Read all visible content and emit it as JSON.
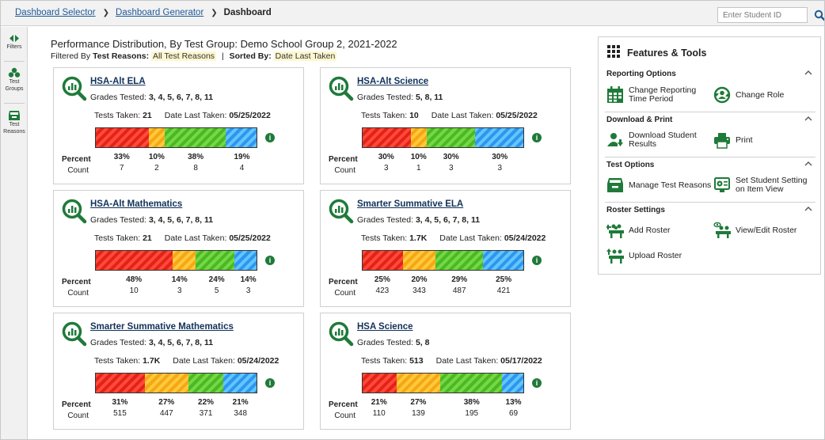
{
  "breadcrumb": {
    "items": [
      "Dashboard Selector",
      "Dashboard Generator"
    ],
    "current": "Dashboard",
    "separator": "❯"
  },
  "search": {
    "placeholder": "Enter Student ID",
    "icon": "search-icon"
  },
  "sidebar": {
    "items": [
      {
        "label1": "Filters",
        "label2": "",
        "icon": "filters-icon"
      },
      {
        "label1": "Test",
        "label2": "Groups",
        "icon": "test-groups-icon"
      },
      {
        "label1": "Test",
        "label2": "Reasons",
        "icon": "test-reasons-icon"
      }
    ]
  },
  "header": {
    "title": "Performance Distribution, By Test Group: Demo School Group 2, 2021-2022",
    "filter_prefix": "Filtered By",
    "filter_key": "Test Reasons:",
    "filter_value": "All Test Reasons",
    "sort_sep": "|",
    "sort_key": "Sorted By:",
    "sort_value": "Date Last Taken"
  },
  "labels": {
    "grades": "Grades Tested:",
    "tests_taken": "Tests Taken:",
    "date_last": "Date Last Taken:",
    "percent": "Percent",
    "count": "Count",
    "info": "i"
  },
  "colors": {
    "level1": "#e42218",
    "level2": "#f6a712",
    "level3": "#4bb825",
    "level4": "#2f96ef",
    "accent": "#1f7a3a",
    "link": "#12325a"
  },
  "cards": [
    {
      "name": "HSA-Alt ELA",
      "grades": "3, 4, 5, 6, 7, 8, 11",
      "tests_taken": "21",
      "date_last": "05/25/2022",
      "percents": [
        "33%",
        "10%",
        "38%",
        "19%"
      ],
      "shares": [
        33,
        10,
        38,
        19
      ],
      "counts": [
        "7",
        "2",
        "8",
        "4"
      ]
    },
    {
      "name": "HSA-Alt Science",
      "grades": "5, 8, 11",
      "tests_taken": "10",
      "date_last": "05/25/2022",
      "percents": [
        "30%",
        "10%",
        "30%",
        "30%"
      ],
      "shares": [
        30,
        10,
        30,
        30
      ],
      "counts": [
        "3",
        "1",
        "3",
        "3"
      ]
    },
    {
      "name": "HSA-Alt Mathematics",
      "grades": "3, 4, 5, 6, 7, 8, 11",
      "tests_taken": "21",
      "date_last": "05/25/2022",
      "percents": [
        "48%",
        "14%",
        "24%",
        "14%"
      ],
      "shares": [
        48,
        14,
        24,
        14
      ],
      "counts": [
        "10",
        "3",
        "5",
        "3"
      ]
    },
    {
      "name": "Smarter Summative ELA",
      "grades": "3, 4, 5, 6, 7, 8, 11",
      "tests_taken": "1.7K",
      "date_last": "05/24/2022",
      "percents": [
        "25%",
        "20%",
        "29%",
        "25%"
      ],
      "shares": [
        25,
        20,
        29,
        25
      ],
      "counts": [
        "423",
        "343",
        "487",
        "421"
      ]
    },
    {
      "name": "Smarter Summative Mathematics",
      "grades": "3, 4, 5, 6, 7, 8, 11",
      "tests_taken": "1.7K",
      "date_last": "05/24/2022",
      "percents": [
        "31%",
        "27%",
        "22%",
        "21%"
      ],
      "shares": [
        31,
        27,
        22,
        21
      ],
      "counts": [
        "515",
        "447",
        "371",
        "348"
      ]
    },
    {
      "name": "HSA Science",
      "grades": "5, 8",
      "tests_taken": "513",
      "date_last": "05/17/2022",
      "percents": [
        "21%",
        "27%",
        "38%",
        "13%"
      ],
      "shares": [
        21,
        27,
        38,
        13
      ],
      "counts": [
        "110",
        "139",
        "195",
        "69"
      ]
    }
  ],
  "panel": {
    "title": "Features & Tools",
    "title_icon": "grid-icon",
    "sections": [
      {
        "title": "Reporting Options",
        "tools": [
          {
            "l1": "Change Reporting",
            "l2": "Time Period",
            "icon": "calendar-icon"
          },
          {
            "l1": "Change Role",
            "l2": "",
            "icon": "change-role-icon"
          }
        ]
      },
      {
        "title": "Download & Print",
        "tools": [
          {
            "l1": "Download Student",
            "l2": "Results",
            "icon": "download-results-icon"
          },
          {
            "l1": "Print",
            "l2": "",
            "icon": "printer-icon"
          }
        ]
      },
      {
        "title": "Test Options",
        "tools": [
          {
            "l1": "Manage Test Reasons",
            "l2": "",
            "icon": "inbox-icon"
          },
          {
            "l1": "Set Student Setting",
            "l2": "on Item View",
            "icon": "settings-monitor-icon"
          }
        ]
      },
      {
        "title": "Roster Settings",
        "tools": [
          {
            "l1": "Add Roster",
            "l2": "",
            "icon": "add-roster-icon"
          },
          {
            "l1": "View/Edit Roster",
            "l2": "",
            "icon": "view-roster-icon"
          },
          {
            "l1": "Upload Roster",
            "l2": "",
            "icon": "upload-roster-icon"
          }
        ]
      }
    ]
  }
}
